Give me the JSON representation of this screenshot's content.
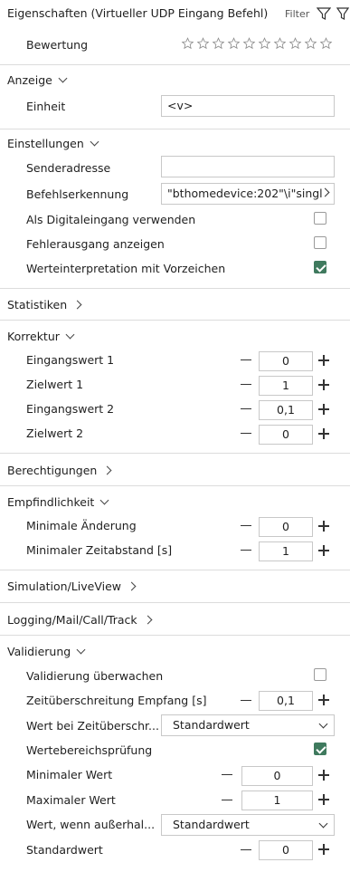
{
  "header": {
    "title": "Eigenschaften (Virtueller UDP Eingang Befehl)",
    "filter_label": "Filter"
  },
  "rating": {
    "label": "Bewertung",
    "stars_total": 10,
    "stars_filled": 0
  },
  "sections": {
    "anzeige": "Anzeige",
    "einstellungen": "Einstellungen",
    "statistiken": "Statistiken",
    "korrektur": "Korrektur",
    "berechtigungen": "Berechtigungen",
    "empfindlichkeit": "Empfindlichkeit",
    "simulation": "Simulation/LiveView",
    "logging": "Logging/Mail/Call/Track",
    "validierung": "Validierung"
  },
  "anzeige": {
    "einheit_label": "Einheit",
    "einheit_value": "<v>"
  },
  "einstellungen": {
    "senderadresse_label": "Senderadresse",
    "senderadresse_value": "",
    "befehl_label": "Befehlserkennung",
    "befehl_value": "\"bthomedevice:202\"\\i\"singl",
    "digital_label": "Als Digitaleingang verwenden",
    "digital_checked": false,
    "fehler_label": "Fehlerausgang anzeigen",
    "fehler_checked": false,
    "vorzeichen_label": "Werteinterpretation mit Vorzeichen",
    "vorzeichen_checked": true
  },
  "korrektur": {
    "eingang1_label": "Eingangswert 1",
    "eingang1_value": "0",
    "ziel1_label": "Zielwert 1",
    "ziel1_value": "1",
    "eingang2_label": "Eingangswert 2",
    "eingang2_value": "0,1",
    "ziel2_label": "Zielwert 2",
    "ziel2_value": "0"
  },
  "empfindlichkeit": {
    "min_aend_label": "Minimale Änderung",
    "min_aend_value": "0",
    "min_zeit_label": "Minimaler Zeitabstand [s]",
    "min_zeit_value": "1"
  },
  "validierung": {
    "ueberwachen_label": "Validierung überwachen",
    "ueberwachen_checked": false,
    "timeout_label": "Zeitüberschreitung Empfang [s]",
    "timeout_value": "0,1",
    "wert_timeout_label": "Wert bei Zeitüberschr...",
    "wert_timeout_value": "Standardwert",
    "bereich_label": "Wertebereichsprüfung",
    "bereich_checked": true,
    "min_label": "Minimaler Wert",
    "min_value": "0",
    "max_label": "Maximaler Wert",
    "max_value": "1",
    "ausserhalb_label": "Wert, wenn außerhal...",
    "ausserhalb_value": "Standardwert",
    "standard_label": "Standardwert",
    "standard_value": "0"
  },
  "colors": {
    "checkbox_checked": "#3f7a5e",
    "separator": "#dcdcdc"
  }
}
